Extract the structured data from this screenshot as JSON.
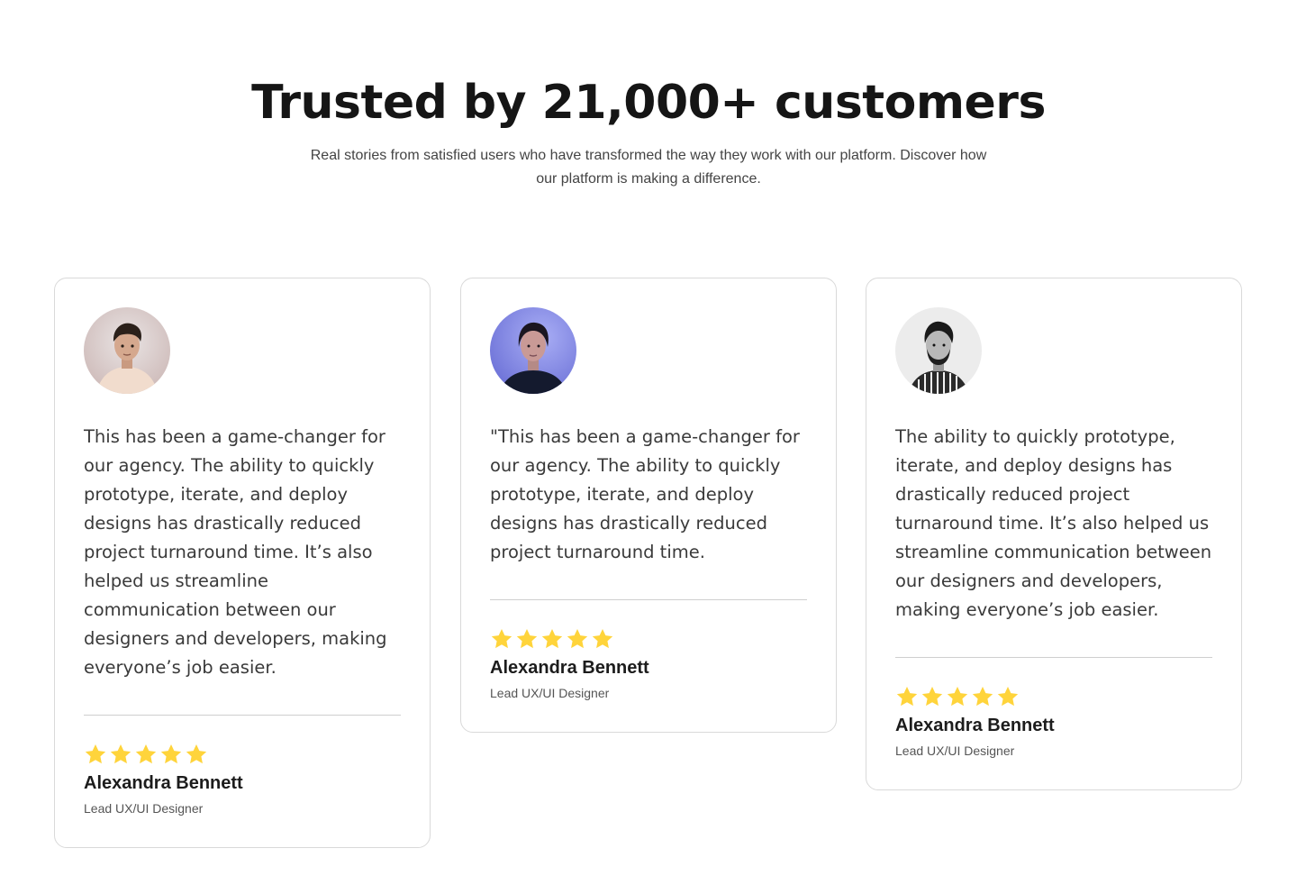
{
  "header": {
    "title": "Trusted by 21,000+ customers",
    "subtitle": "Real stories from satisfied users who have transformed the way they work with our platform. Discover how our platform is making a difference."
  },
  "colors": {
    "star": "#FFD43B",
    "border": "#D9D9D9"
  },
  "testimonials": [
    {
      "quote": "This has been a game-changer for our agency. The ability to quickly prototype, iterate, and deploy designs has drastically reduced project turnaround time. It’s also helped us streamline communication between our designers and developers, making everyone’s job easier.",
      "rating": 5,
      "name": "Alexandra Bennett",
      "role": "Lead UX/UI Designer"
    },
    {
      "quote": "\"This has been a game-changer for our agency. The ability to quickly prototype, iterate, and deploy designs has drastically reduced project turnaround time.",
      "rating": 5,
      "name": "Alexandra Bennett",
      "role": "Lead UX/UI Designer"
    },
    {
      "quote": "The ability to quickly prototype, iterate, and deploy designs has drastically reduced project turnaround time. It’s also helped us streamline communication between our designers and developers, making everyone’s job easier.",
      "rating": 5,
      "name": "Alexandra Bennett",
      "role": "Lead UX/UI Designer"
    }
  ]
}
